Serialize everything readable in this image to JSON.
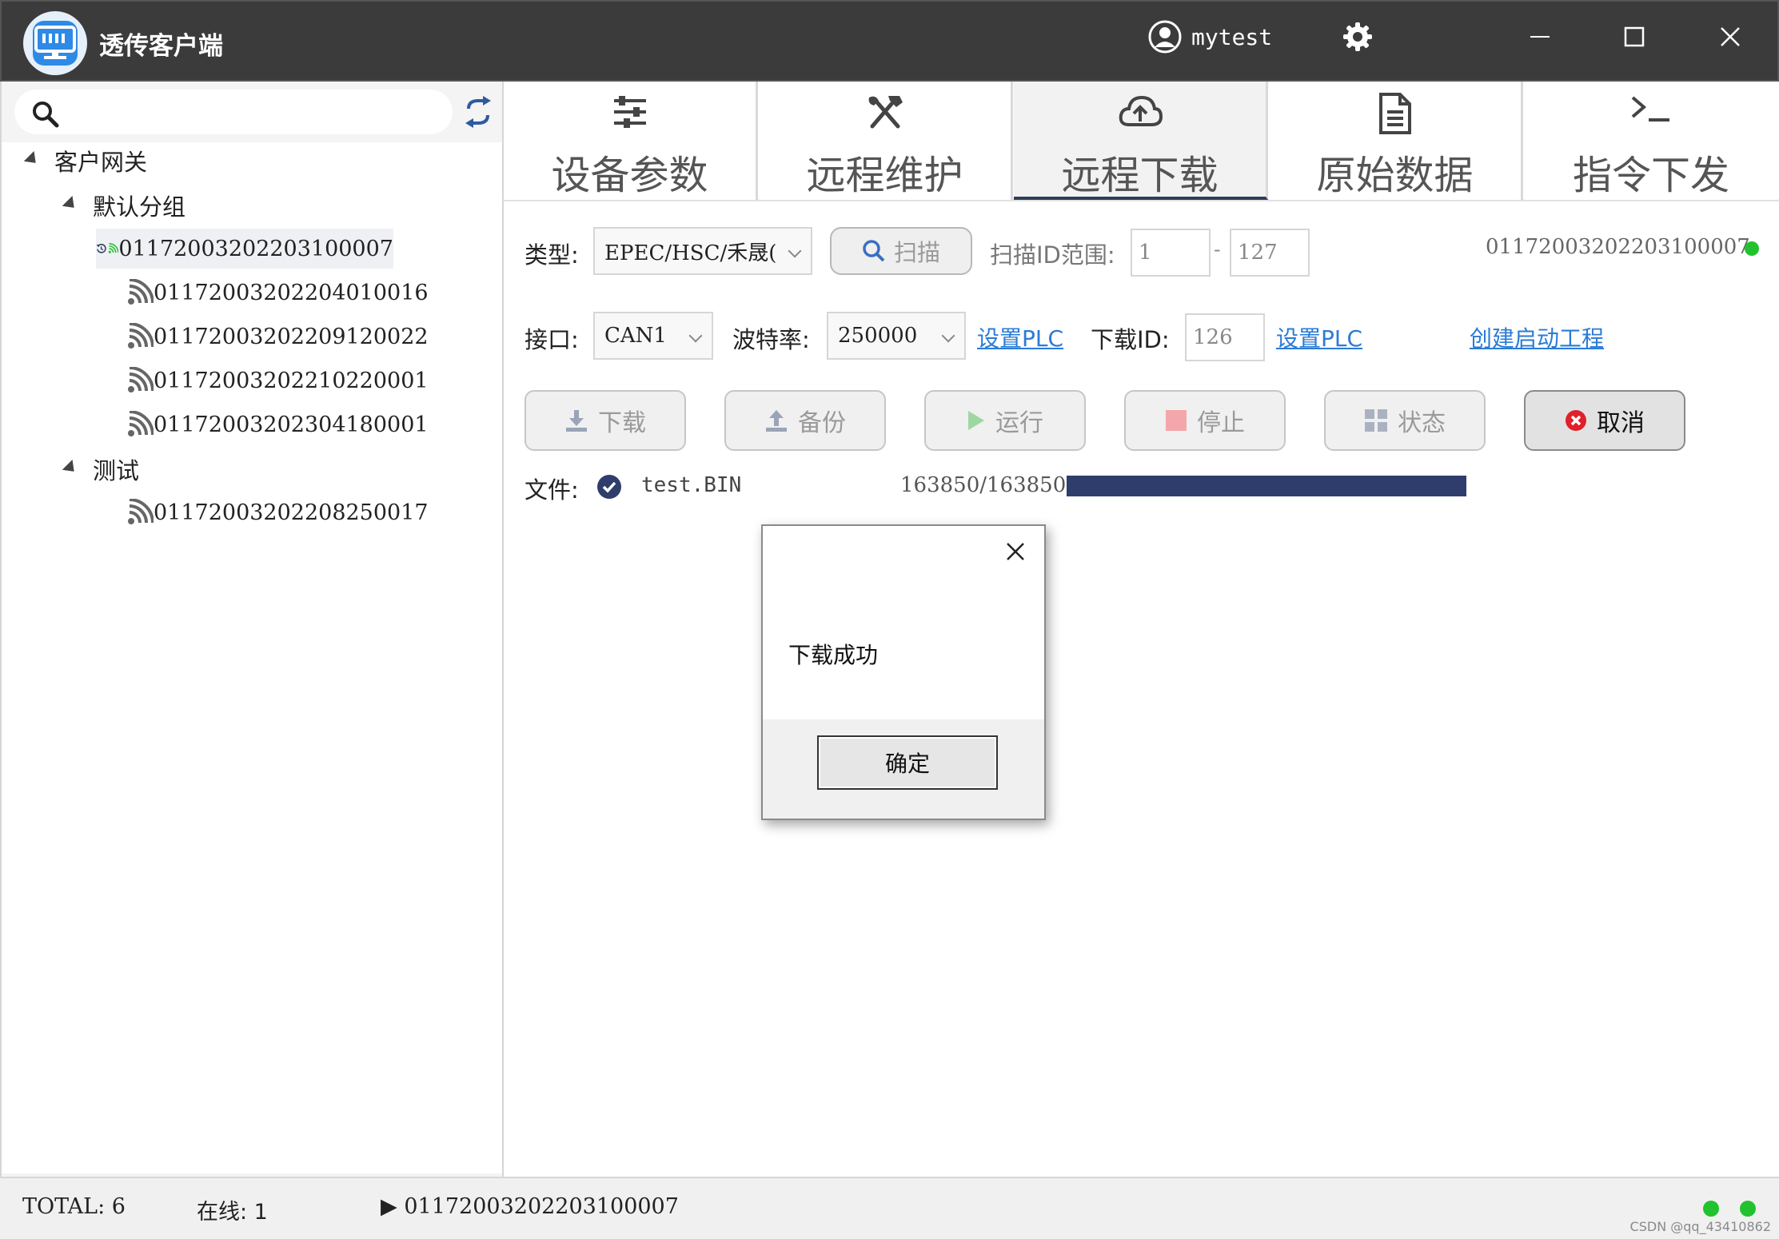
{
  "app": {
    "title": "透传客户端",
    "user": "mytest"
  },
  "search": {
    "placeholder": ""
  },
  "tree": {
    "root": "客户网关",
    "groups": [
      {
        "name": "默认分组",
        "devices": [
          "01172003202203100007",
          "01172003202204010016",
          "01172003202209120022",
          "01172003202210220001",
          "01172003202304180001"
        ]
      },
      {
        "name": "测试",
        "devices": [
          "01172003202208250017"
        ]
      }
    ],
    "selected": "01172003202203100007"
  },
  "tabs": [
    {
      "label": "设备参数",
      "icon": "sliders-icon"
    },
    {
      "label": "远程维护",
      "icon": "tools-icon"
    },
    {
      "label": "远程下载",
      "icon": "cloud-upload-icon",
      "active": true
    },
    {
      "label": "原始数据",
      "icon": "document-icon"
    },
    {
      "label": "指令下发",
      "icon": "terminal-icon"
    }
  ],
  "form": {
    "type_label": "类型:",
    "type_value": "EPEC/HSC/禾晟(",
    "scan_label": "扫描",
    "scan_range_label": "扫描ID范围:",
    "scan_from": "1",
    "scan_sep": "-",
    "scan_to": "127",
    "device_id": "01172003202203100007",
    "port_label": "接口:",
    "port_value": "CAN1",
    "baud_label": "波特率:",
    "baud_value": "250000",
    "set_plc_1": "设置PLC",
    "download_id_label": "下载ID:",
    "download_id_value": "126",
    "set_plc_2": "设置PLC",
    "create_project": "创建启动工程"
  },
  "actions": {
    "download": "下载",
    "backup": "备份",
    "run": "运行",
    "stop": "停止",
    "status": "状态",
    "cancel": "取消"
  },
  "file": {
    "label": "文件:",
    "name": "test.BIN",
    "progress_text": "163850/163850",
    "progress": 1.0
  },
  "dialog": {
    "message": "下载成功",
    "ok": "确定"
  },
  "status": {
    "total": "TOTAL: 6",
    "online": "在线: 1",
    "current": "▶ 01172003202203100007"
  },
  "watermark": "CSDN @qq_43410862",
  "colors": {
    "accent": "#2e3d6b",
    "online": "#22c22e",
    "link": "#2a7bd6",
    "cancel": "#e0202a"
  }
}
